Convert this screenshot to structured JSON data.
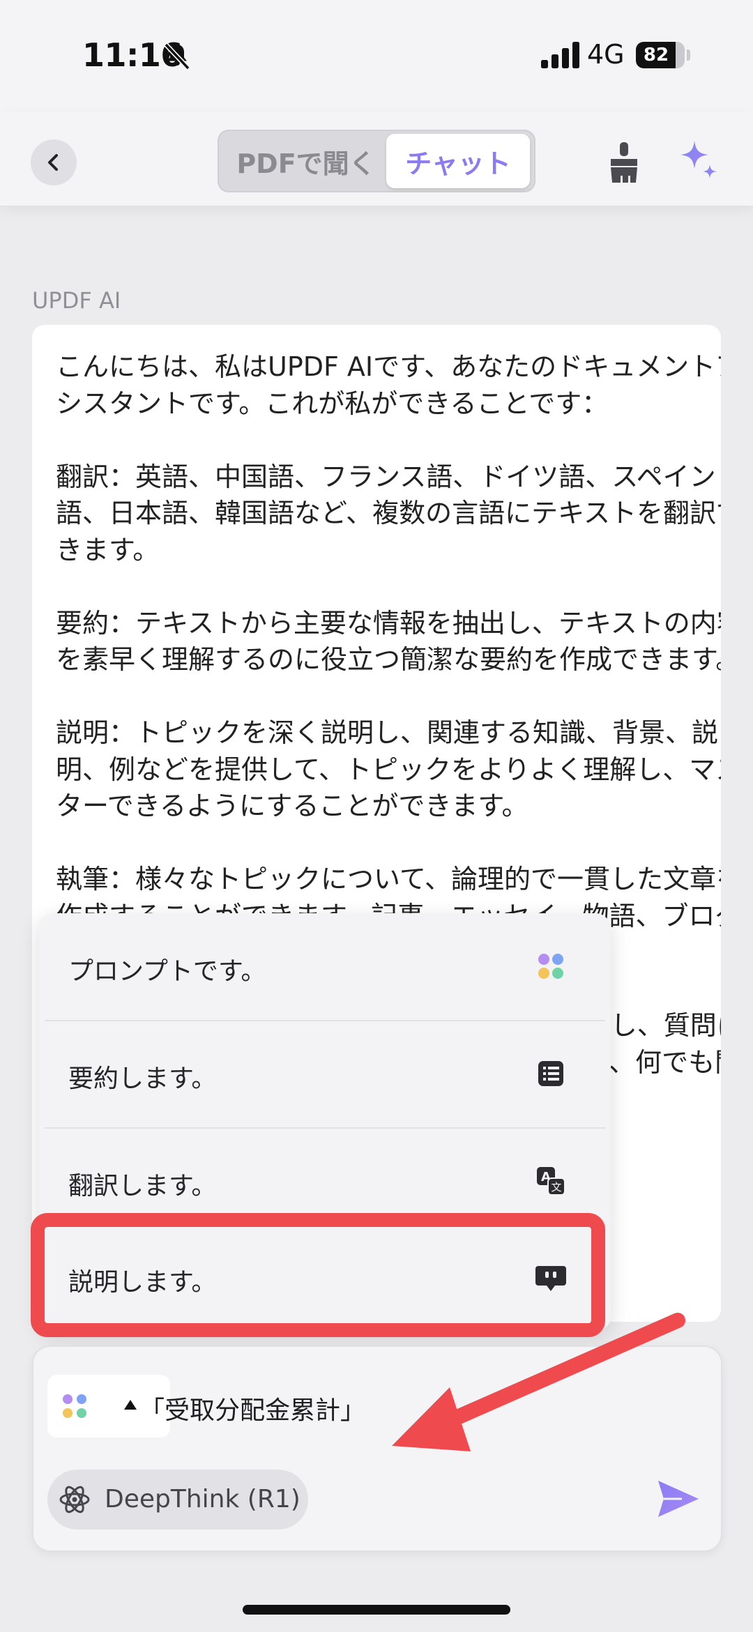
{
  "status_bar": {
    "time": "11:16",
    "network": "4G",
    "battery_level": "82",
    "battery_fraction": 0.82,
    "icons": [
      "bell-muted-icon",
      "signal-icon",
      "battery-icon"
    ]
  },
  "header": {
    "tabs": [
      {
        "label": "PDFで聞く",
        "active": false
      },
      {
        "label": "チャット",
        "active": true
      }
    ],
    "icons": [
      "back-chevron-icon",
      "broom-icon",
      "sparkle-icon"
    ]
  },
  "chat": {
    "sender": "UPDF AI",
    "message": "こんにちは、私はUPDF AIです、あなたのドキュメントアシスタントです。これが私ができることです：\n\n翻訳：英語、中国語、フランス語、ドイツ語、スペイン語、日本語、韓国語など、複数の言語にテキストを翻訳できます。\n\n要約：テキストから主要な情報を抽出し、テキストの内容を素早く理解するのに役立つ簡潔な要約を作成できます。\n\n説明：トピックを深く説明し、関連する知識、背景、説明、例などを提供して、トピックをよりよく理解し、マスターできるようにすることができます。\n\n執筆：様々なトピックについて、論理的で一貫した文章を作成することができます。記事、エッセイ、物語、ブログ投稿など、さまざまな種類の文章を書けます。\n\nチャット：ドキュメントの内容に直接アクセスし、質問に答えることができます。ご質問がありましたら、何でも聞いてください。"
  },
  "prompt_menu": {
    "items": [
      {
        "label": "プロンプトです。",
        "icon": "prompt-dots-icon"
      },
      {
        "label": "要約します。",
        "icon": "list-icon"
      },
      {
        "label": "翻訳します。",
        "icon": "translate-icon"
      },
      {
        "label": "説明します。",
        "icon": "explain-bubble-icon"
      }
    ],
    "highlighted_item": "説明します。"
  },
  "composer": {
    "quoted_text": "「受取分配金累計」",
    "deepthink_label": "DeepThink (R1)",
    "icons": [
      "prompt-dots-icon",
      "caret-up-icon",
      "atom-icon",
      "send-icon"
    ]
  },
  "colors": {
    "accent": "#8b7bf3",
    "highlight_red": "#ef4a4d",
    "background": "#ececef",
    "card": "#ffffff"
  }
}
